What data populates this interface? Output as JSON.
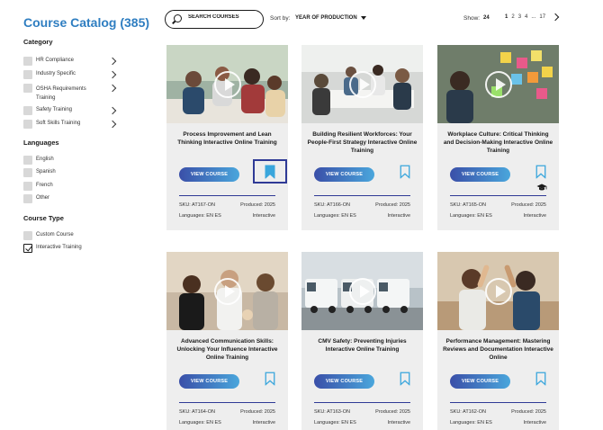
{
  "catalog": {
    "title": "Course Catalog (385)"
  },
  "search": {
    "placeholder": "SEARCH COURSES"
  },
  "sort": {
    "label": "Sort by:",
    "value": "YEAR OF PRODUCTION"
  },
  "show": {
    "label": "Show:",
    "value": "24"
  },
  "pagination": {
    "pages": [
      "1",
      "2",
      "3",
      "4",
      "...",
      "17"
    ],
    "current": "1"
  },
  "sidebar": {
    "category_title": "Category",
    "categories": [
      {
        "label": "HR Compliance"
      },
      {
        "label": "Industry Specific"
      },
      {
        "label": "OSHA Requirements Training"
      },
      {
        "label": "Safety Training"
      },
      {
        "label": "Soft Skills Training"
      }
    ],
    "languages_title": "Languages",
    "languages": [
      {
        "label": "English"
      },
      {
        "label": "Spanish"
      },
      {
        "label": "French"
      },
      {
        "label": "Other"
      }
    ],
    "course_type_title": "Course Type",
    "course_types": [
      {
        "label": "Custom Course",
        "checked": false
      },
      {
        "label": "Interactive Training",
        "checked": true
      }
    ]
  },
  "colors": {
    "accent": "#2f7ec1",
    "button_start": "#3a4fa8",
    "button_end": "#4aa6dc",
    "bookmark": "#3aa6dc"
  },
  "cards": [
    {
      "title": "Process Improvement and Lean Thinking Interactive Online Training",
      "button": "VIEW COURSE",
      "sku": "SKU: AT167-ON",
      "produced": "Produced: 2025",
      "languages": "Languages: EN ES",
      "type": "Interactive",
      "bookmarked": true
    },
    {
      "title": "Building Resilient Workforces: Your People-First Strategy Interactive Online Training",
      "button": "VIEW COURSE",
      "sku": "SKU: AT166-ON",
      "produced": "Produced: 2025",
      "languages": "Languages: EN ES",
      "type": "Interactive",
      "bookmarked": false
    },
    {
      "title": "Workplace Culture: Critical Thinking and Decision-Making Interactive Online Training",
      "button": "VIEW COURSE",
      "sku": "SKU: AT165-ON",
      "produced": "Produced: 2025",
      "languages": "Languages: EN ES",
      "type": "Interactive",
      "bookmarked": false
    },
    {
      "title": "Advanced Communication Skills: Unlocking Your Influence Interactive Online Training",
      "button": "VIEW COURSE",
      "sku": "SKU: AT164-ON",
      "produced": "Produced: 2025",
      "languages": "Languages: EN ES",
      "type": "Interactive",
      "bookmarked": false
    },
    {
      "title": "CMV Safety: Preventing Injuries Interactive Online Training",
      "button": "VIEW COURSE",
      "sku": "SKU: AT163-ON",
      "produced": "Produced: 2025",
      "languages": "Languages: EN ES",
      "type": "Interactive",
      "bookmarked": false
    },
    {
      "title": "Performance Management: Mastering Reviews and Documentation Interactive Online",
      "button": "VIEW COURSE",
      "sku": "SKU: AT162-ON",
      "produced": "Produced: 2025",
      "languages": "Languages: EN ES",
      "type": "Interactive",
      "bookmarked": false
    }
  ]
}
